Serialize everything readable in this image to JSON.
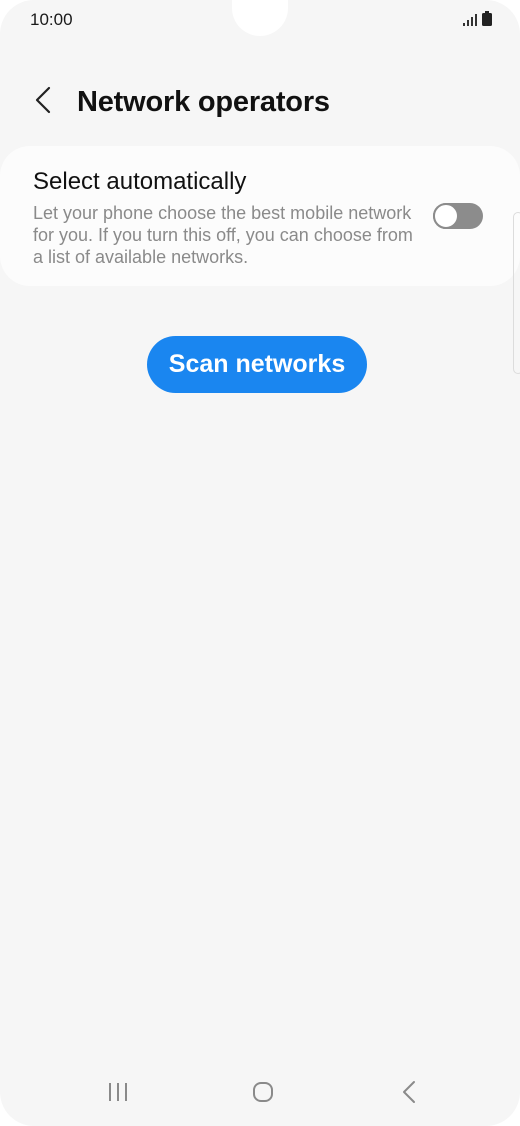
{
  "status_bar": {
    "time": "10:00",
    "icons": [
      "signal-icon",
      "battery-icon"
    ]
  },
  "header": {
    "title": "Network operators",
    "back_icon": "chevron-left-icon"
  },
  "select_automatically": {
    "title": "Select automatically",
    "description": "Let your phone choose the best mobile network for you. If you turn this off, you can choose from a list of available networks.",
    "enabled": false
  },
  "actions": {
    "scan_label": "Scan networks"
  },
  "nav_bar": {
    "buttons": [
      "recent-apps-icon",
      "home-icon",
      "back-icon"
    ]
  },
  "colors": {
    "accent": "#1a86f0",
    "background": "#f6f6f6",
    "card": "#fcfcfc",
    "toggle_off": "#8c8c8c"
  }
}
